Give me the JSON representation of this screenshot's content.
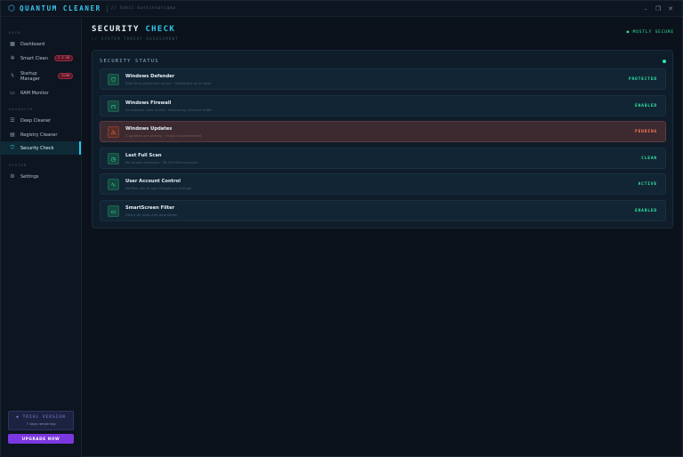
{
  "app": {
    "title": "QUANTUM CLEANER",
    "subtitle": "// Sahil Gustinsarigma",
    "controls": {
      "minimize": "–",
      "maximize": "❐",
      "close": "✕"
    }
  },
  "sidebar": {
    "sections": [
      {
        "label": "MAIN"
      },
      {
        "label": "ADVANCED"
      },
      {
        "label": "SYSTEM"
      }
    ],
    "items": [
      {
        "label": "Dashboard",
        "icon": "grid-icon"
      },
      {
        "label": "Smart Clean",
        "icon": "sparkle-icon",
        "badge": "2.3 GB"
      },
      {
        "label": "Startup Manager",
        "icon": "bolt-icon",
        "badge": "SLOW"
      },
      {
        "label": "RAM Monitor",
        "icon": "memory-icon"
      },
      {
        "label": "Deep Cleaner",
        "icon": "layers-icon"
      },
      {
        "label": "Registry Cleaner",
        "icon": "registry-icon"
      },
      {
        "label": "Security Check",
        "icon": "shield-icon",
        "active": true
      },
      {
        "label": "Settings",
        "icon": "gear-icon"
      }
    ],
    "trial": {
      "title": "◆ TRIAL VERSION",
      "subtitle": "7 days remaining"
    },
    "upgrade_label": "UPGRADE NOW"
  },
  "main": {
    "title_prefix": "SECURITY",
    "title_accent": "CHECK",
    "subtitle": "// SYSTEM THREAT ASSESSMENT",
    "overall_status": "● MOSTLY SECURE",
    "panel_title": "SECURITY STATUS",
    "checks": [
      {
        "name": "Windows Defender",
        "description": "Real-time protection active · Definitions up to date",
        "status": "PROTECTED",
        "icon": "shield-icon",
        "state": "ok"
      },
      {
        "name": "Windows Firewall",
        "description": "All network rules active · Monitoring inbound traffic",
        "status": "ENABLED",
        "icon": "lock-icon",
        "state": "ok"
      },
      {
        "name": "Windows Updates",
        "description": "3 updates are waiting · Install recommended",
        "status": "PENDING",
        "icon": "warning-icon",
        "state": "warn"
      },
      {
        "name": "Last Full Scan",
        "description": "No threats detected · 28,193 files scanned",
        "status": "CLEAN",
        "icon": "clock-icon",
        "state": "ok"
      },
      {
        "name": "User Account Control",
        "description": "Notifies you of app changes to settings",
        "status": "ACTIVE",
        "icon": "activity-icon",
        "state": "ok"
      },
      {
        "name": "SmartScreen Filter",
        "description": "Filters for apps and downloads",
        "status": "ENABLED",
        "icon": "monitor-icon",
        "state": "ok"
      }
    ]
  },
  "colors": {
    "accent": "#2fc4e8",
    "ok": "#2ee8a6",
    "warn": "#ff7f55",
    "upgrade": "#7b38e0"
  }
}
